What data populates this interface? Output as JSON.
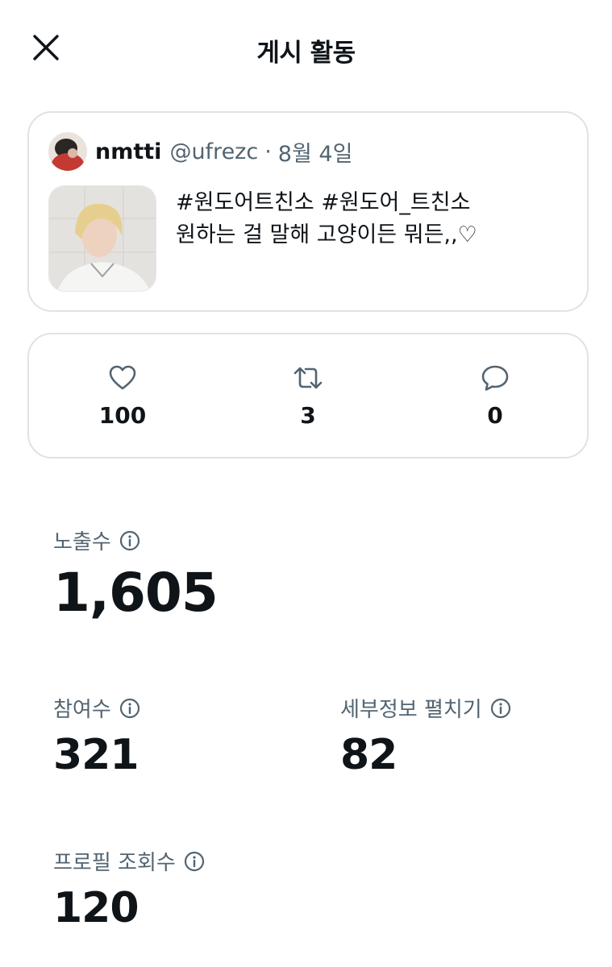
{
  "header": {
    "title": "게시 활동"
  },
  "post": {
    "author_name": "nmtti",
    "author_handle": "@ufrezc",
    "separator": "·",
    "date": "8월 4일",
    "text_line1": "#원도어트친소 #원도어_트친소",
    "text_line2": "원하는 걸 말해 고양이든 뭐든,,♡"
  },
  "metrics": {
    "likes": "100",
    "reposts": "3",
    "replies": "0"
  },
  "stats": {
    "impressions_label": "노출수",
    "impressions_value": "1,605",
    "engagements_label": "참여수",
    "engagements_value": "321",
    "detail_expands_label": "세부정보 펼치기",
    "detail_expands_value": "82",
    "profile_visits_label": "프로필 조회수",
    "profile_visits_value": "120"
  },
  "colors": {
    "text": "#0f1419",
    "muted": "#536471",
    "border": "#dfe3e6"
  },
  "icons": [
    "close-icon",
    "heart-icon",
    "repost-icon",
    "reply-icon",
    "info-icon"
  ]
}
